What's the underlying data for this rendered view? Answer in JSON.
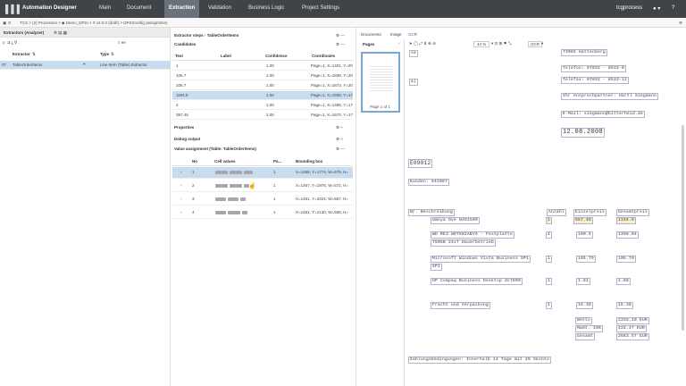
{
  "app": {
    "title": "Automation Designer",
    "user": "tcgprocess",
    "user_icon": "user-icon"
  },
  "nav": {
    "tabs": [
      "Main",
      "Document",
      "Extraction",
      "Validation",
      "Business Logic",
      "Project Settings"
    ],
    "active": "Extraction"
  },
  "breadcrumb": "TCS > (2) Processes > ◆ Demo_DPSI > # v2.0.0 (draft) > DPSIConfig (assigntime)",
  "extractors": {
    "title": "Extractors (Analyzer)",
    "search": "ee",
    "col_extractor": "Extractor",
    "col_type": "Type",
    "rows": [
      {
        "num": "0?",
        "name": "TableOrderItems",
        "type": "Line Item (Table) Extractor"
      }
    ]
  },
  "candidates": {
    "panel_title": "Extractor steps - TableOrderItems",
    "section": "Candidates",
    "cols": [
      "Text",
      "Label",
      "Confidence",
      "Coordinates"
    ],
    "rows": [
      {
        "text": "1",
        "conf": "1.00",
        "coord": "Page=1, X=1401, Y=20"
      },
      {
        "text": "105.7",
        "conf": "1.00",
        "coord": "Page=1, X=1938, Y=20"
      },
      {
        "text": "105.7",
        "conf": "1.00",
        "coord": "Page=1, X=1673, Y=20"
      },
      {
        "text": "1194.9",
        "conf": "1.00",
        "coord": "Page=1, X=1938, Y=17"
      },
      {
        "text": "2",
        "conf": "1.00",
        "coord": "Page=1, X=1485, Y=17"
      },
      {
        "text": "397.45",
        "conf": "1.00",
        "coord": "Page=1, X=1670, Y=17"
      }
    ]
  },
  "properties": "Properties",
  "debug": "Debug output",
  "assign": {
    "title": "Value assignment (Table: TableOrderItems)",
    "cols": [
      "No",
      "Cell values",
      "Pa...",
      "Bounding box"
    ],
    "rows": [
      {
        "no": "1",
        "page": "1",
        "bbox": "X=1488, Y=1774, W=579, H="
      },
      {
        "no": "2",
        "page": "1",
        "bbox": "X=1467, Y=1976, W=572, H="
      },
      {
        "no": "3",
        "page": "1",
        "bbox": "X=1461, Y=2224, W=567, H="
      },
      {
        "no": "4",
        "page": "1",
        "bbox": "X=1491, Y=2130, W=568, H="
      }
    ]
  },
  "viewer": {
    "tabs": [
      "Documents",
      "Image",
      "OCR"
    ],
    "pages_label": "Pages",
    "page_caption": "Page 1 of 1",
    "zoom": "44 %",
    "mode": "OCR"
  },
  "ocr": {
    "address": [
      "73065 Hattenberg",
      "Telefon: 07032 - 8533-0",
      "Telefax: 07032 - 8533-12",
      "Ihr Ansprechpartner: Hartl Siegmann",
      "E-Mail: siegmann@bitterheid.de",
      "12.08.2008"
    ],
    "numbers": [
      "E09812",
      "Kunden: 942087"
    ],
    "left": [
      "Nr. Beschreibung"
    ],
    "items": [
      {
        "desc": "Umnya Ove N3S4500",
        "qty": "1",
        "price": "557.45",
        "total": "1194.9"
      },
      {
        "desc": "WD RE3 WD7502ABYS - Festplatte",
        "desc2": "750GB 24x7 Dauerbetrieb",
        "qty": "4",
        "price": "100.5",
        "total": "1398.04"
      },
      {
        "desc": "Microsoft Windows Vista Business SP1",
        "qty": "1",
        "price": "105.79",
        "total": "105.70"
      },
      {
        "desc": "HP Compaq Business Desktop dc7800",
        "qty": "1",
        "price": "1.61",
        "total": "1.88"
      },
      {
        "desc": "Fracht und Verpackung",
        "qty": "1",
        "price": "15.38",
        "total": "15.38"
      }
    ],
    "summary": [
      {
        "label": "Netto",
        "value": "2255.10 EUR"
      },
      {
        "label": "MwSt. 19%",
        "value": "428.47 EUR"
      },
      {
        "label": "Gesamt",
        "value": "2683.57 EUR"
      }
    ],
    "footer": "Zahlungsbedingungen: Innerhalb 14 Tage mit 2% Skonto"
  }
}
